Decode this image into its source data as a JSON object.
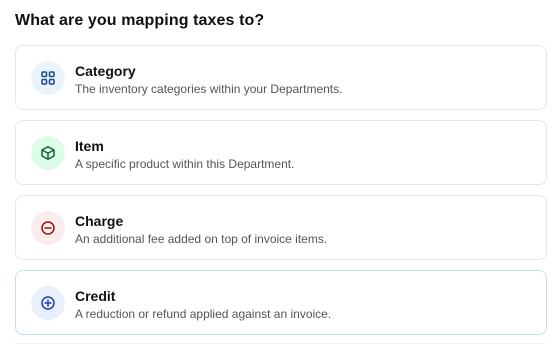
{
  "heading": "What are you mapping taxes to?",
  "options": [
    {
      "label": "Category",
      "description": "The inventory categories within your Departments.",
      "icon": "grid-icon",
      "icon_color": "#1f4f8f",
      "icon_bg": "#eaf2fb"
    },
    {
      "label": "Item",
      "description": "A specific product within this Department.",
      "icon": "box-icon",
      "icon_color": "#166534",
      "icon_bg": "#dcfce7"
    },
    {
      "label": "Charge",
      "description": "An additional fee added on top of invoice items.",
      "icon": "minus-circle-icon",
      "icon_color": "#8b1d1d",
      "icon_bg": "#fdecec"
    },
    {
      "label": "Credit",
      "description": "A reduction or refund applied against an invoice.",
      "icon": "plus-circle-icon",
      "icon_color": "#1e40af",
      "icon_bg": "#e8f0fc"
    }
  ]
}
